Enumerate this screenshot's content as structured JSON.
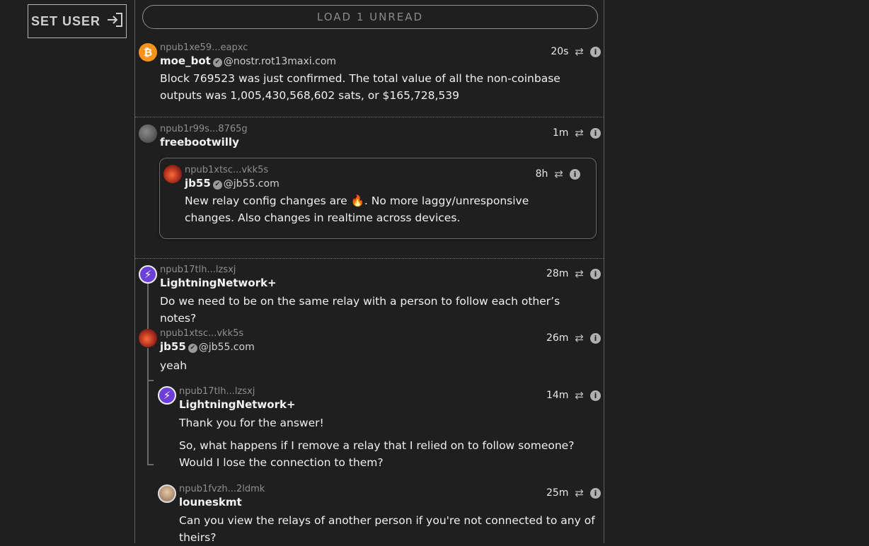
{
  "sidebar": {
    "set_user_label": "SET USER"
  },
  "feed": {
    "load_unread_label": "LOAD 1 UNREAD",
    "notes": [
      {
        "npub": "npub1xe59...eapxc",
        "name": "moe_bot",
        "nip05": "@nostr.rot13maxi.com",
        "time": "20s",
        "content": "Block 769523 was just confirmed. The total value of all the non-coinbase outputs was 1,005,430,568,602 sats, or $165,728,539"
      },
      {
        "npub": "npub1r99s...8765g",
        "name": "freebootwilly",
        "time": "1m",
        "quoted": {
          "npub": "npub1xtsc...vkk5s",
          "name": "jb55",
          "nip05": "@jb55.com",
          "time": "8h",
          "content": "New relay config changes are 🔥. No more laggy/unresponsive changes. Also changes in realtime across devices."
        }
      },
      {
        "npub": "npub17tlh...lzsxj",
        "name": "LightningNetwork+",
        "time": "28m",
        "content": "Do we need to be on the same relay with a person to follow each other’s notes?"
      },
      {
        "npub": "npub1xtsc...vkk5s",
        "name": "jb55",
        "nip05": "@jb55.com",
        "time": "26m",
        "content": "yeah"
      },
      {
        "npub": "npub17tlh...lzsxj",
        "name": "LightningNetwork+",
        "time": "14m",
        "content_p1": "Thank you for the answer!",
        "content_p2": "So, what happens if I remove a relay that I relied on to follow someone? Would I lose the connection to them?"
      },
      {
        "npub": "npub1fvzh...2ldmk",
        "name": "louneskmt",
        "time": "25m",
        "content": "Can you view the relays of another person if you're not connected to any of theirs?"
      }
    ]
  },
  "icons": {
    "repost": "⇄",
    "info": "i",
    "bitcoin": "₿",
    "lightning": "⚡",
    "verified": "✔",
    "login": "⇥"
  }
}
